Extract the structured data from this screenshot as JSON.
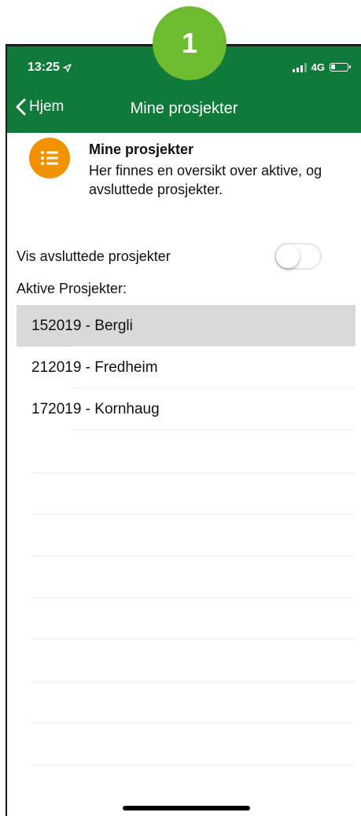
{
  "step_badge": "1",
  "status_bar": {
    "time": "13:25",
    "network": "4G"
  },
  "nav": {
    "back_label": "Hjem",
    "title": "Mine prosjekter"
  },
  "info": {
    "icon": "list-icon",
    "heading": "Mine prosjekter",
    "description": "Her finnes en oversikt over aktive, og avsluttede prosjekter."
  },
  "toggle": {
    "label": "Vis avsluttede prosjekter",
    "checked": false
  },
  "section_label": "Aktive Prosjekter:",
  "projects": [
    {
      "label": "152019 - Bergli",
      "selected": true
    },
    {
      "label": "212019 - Fredheim",
      "selected": false
    },
    {
      "label": "172019 - Kornhaug",
      "selected": false
    }
  ],
  "colors": {
    "header_green": "#0f7a39",
    "badge_green": "#6dbb2f",
    "icon_orange": "#f39200",
    "selected_row": "#d9d9d9"
  }
}
